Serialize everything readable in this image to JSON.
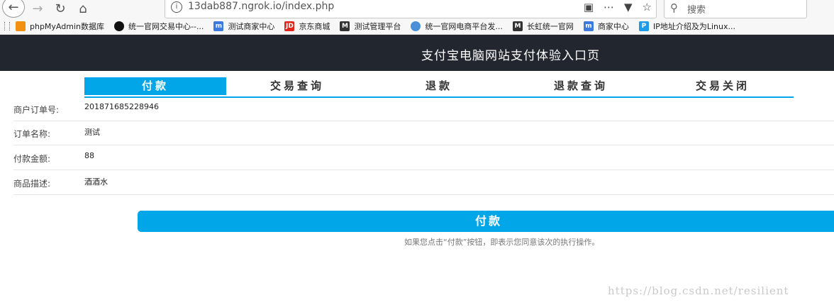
{
  "browser": {
    "url": "13dab887.ngrok.io/index.php",
    "search_placeholder": "搜索",
    "icons": [
      "back-icon",
      "forward-icon",
      "reload-icon",
      "home-icon",
      "info-icon",
      "qr-icon",
      "more-icon",
      "pocket-icon",
      "star-icon",
      "search-icon"
    ]
  },
  "bookmarks": [
    {
      "label": "phpMyAdmin数据库",
      "icon": "phpmyadmin-icon",
      "color": "#f29111"
    },
    {
      "label": "统一官网交易中心--...",
      "icon": "compass-icon",
      "color": "#111111"
    },
    {
      "label": "测试商家中心",
      "icon": "m-logo-icon",
      "color": "#3b7be0"
    },
    {
      "label": "京东商城",
      "icon": "jd-icon",
      "color": "#e1251b"
    },
    {
      "label": "测试管理平台",
      "icon": "m-logo-icon",
      "color": "#333333"
    },
    {
      "label": "统一官网电商平台发...",
      "icon": "globe-icon",
      "color": "#4a90d9"
    },
    {
      "label": "长虹统一官网",
      "icon": "m-logo-icon",
      "color": "#333333"
    },
    {
      "label": "商家中心",
      "icon": "m-logo-icon",
      "color": "#3b7be0"
    },
    {
      "label": "IP地址介绍及为Linux...",
      "icon": "ip-icon",
      "color": "#1e9be8"
    }
  ],
  "header": {
    "title": "支付宝电脑网站支付体验入口页"
  },
  "tabs": [
    {
      "label": "付款",
      "active": true
    },
    {
      "label": "交易查询",
      "active": false
    },
    {
      "label": "退款",
      "active": false
    },
    {
      "label": "退款查询",
      "active": false
    },
    {
      "label": "交易关闭",
      "active": false
    }
  ],
  "form": {
    "rows": [
      {
        "label": "商户订单号:",
        "value": "201871685228946"
      },
      {
        "label": "订单名称:",
        "value": "测试"
      },
      {
        "label": "付款金额:",
        "value": "88"
      },
      {
        "label": "商品描述:",
        "value": "酒酒水"
      }
    ]
  },
  "pay": {
    "button_label": "付款",
    "note": "如果您点击“付款”按钮，即表示您同意该次的执行操作。"
  },
  "watermark": "https://blog.csdn.net/resilient",
  "colors": {
    "accent": "#00a6e8",
    "header_bg": "#22262e"
  }
}
